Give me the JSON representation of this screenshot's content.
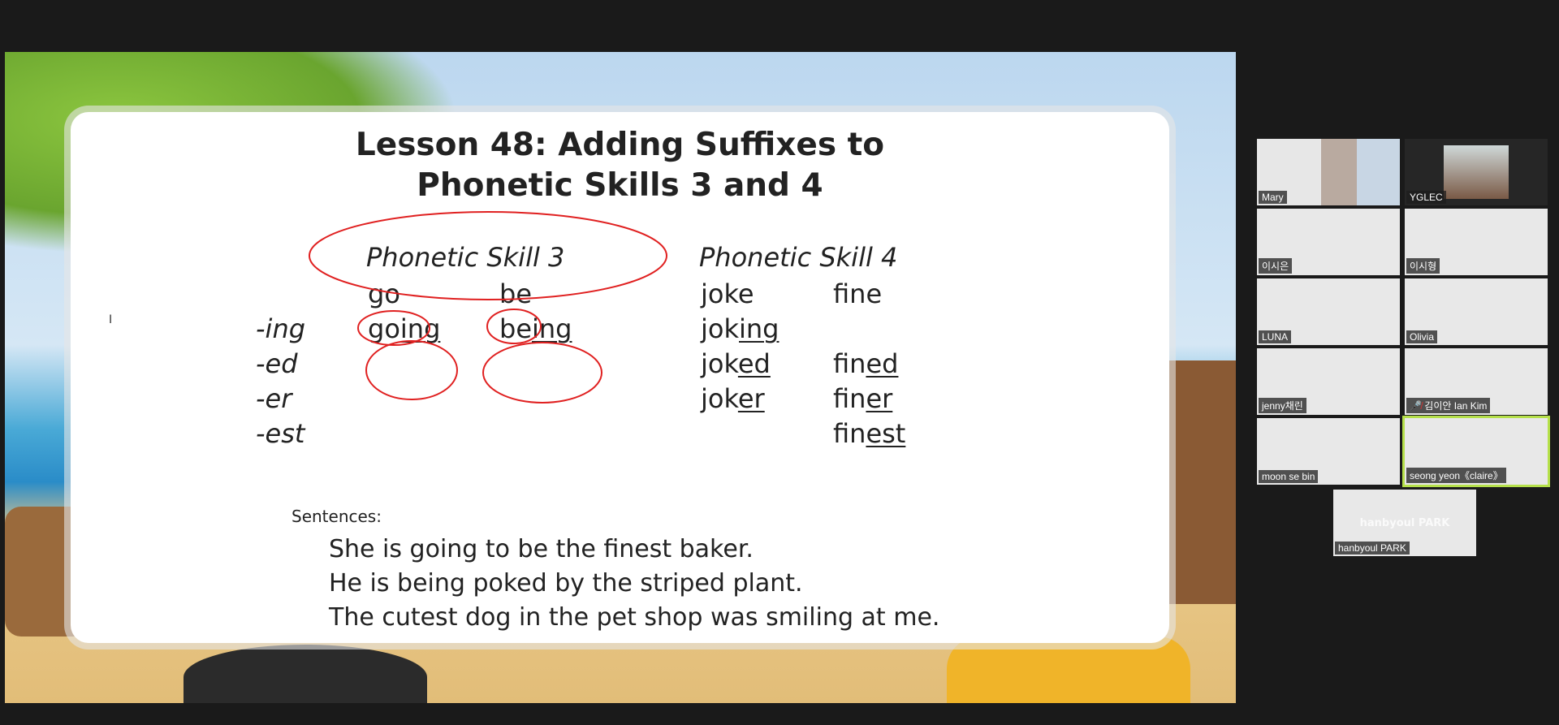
{
  "slide": {
    "title_line1": "Lesson 48: Adding Suffixes to",
    "title_line2": "Phonetic Skills 3 and 4",
    "skill3_header": "Phonetic Skill 3",
    "skill4_header": "Phonetic Skill 4",
    "suffixes": [
      "-ing",
      "-ed",
      "-er",
      "-est"
    ],
    "skill3": {
      "base": [
        "go",
        "be"
      ],
      "ing": [
        [
          "go",
          "ing"
        ],
        [
          "be",
          "ing"
        ]
      ]
    },
    "skill4": {
      "base": [
        "joke",
        "fine"
      ],
      "joke_forms": [
        [
          "jok",
          "ing"
        ],
        [
          "jok",
          "ed"
        ],
        [
          "jok",
          "er"
        ]
      ],
      "fine_forms": [
        [
          "fin",
          "ed"
        ],
        [
          "fin",
          "er"
        ],
        [
          "fin",
          "est"
        ]
      ]
    },
    "sentences_label": "Sentences:",
    "sentences": [
      "She is going to be the finest baker.",
      "He is being poked by the striped plant.",
      "The cutest dog in the pet shop was smiling at me."
    ],
    "annotation_color": "#e02020"
  },
  "participants": [
    {
      "name": "Mary",
      "video": true
    },
    {
      "name": "YGLEC",
      "video": true
    },
    {
      "name": "이시은"
    },
    {
      "name": "이시형"
    },
    {
      "name": "LUNA"
    },
    {
      "name": "Olivia"
    },
    {
      "name": "jenny채린"
    },
    {
      "name": "김이안 Ian Kim",
      "muted": true
    },
    {
      "name": "moon se bin"
    },
    {
      "name": "seong yeon《claire》",
      "active_speaker": true
    },
    {
      "name": "hanbyoul PARK",
      "watermark": "hanbyoul PARK"
    }
  ]
}
